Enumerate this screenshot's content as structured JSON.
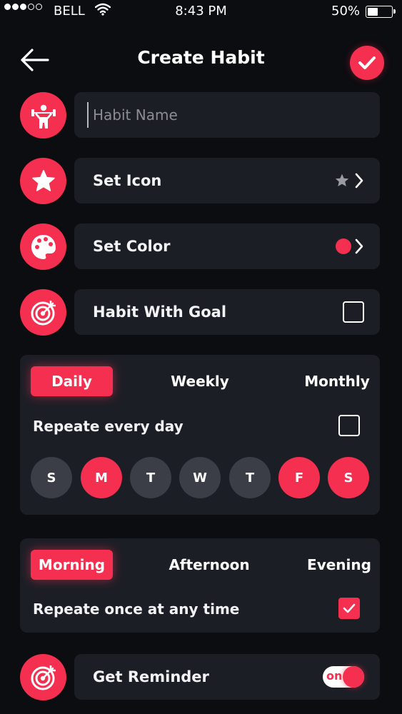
{
  "status": {
    "carrier": "BELL",
    "time": "8:43 PM",
    "battery": "50%",
    "battery_level": 0.5
  },
  "header": {
    "title": "Create Habit"
  },
  "name_field": {
    "placeholder": "Habit Name",
    "value": ""
  },
  "set_icon": {
    "label": "Set Icon"
  },
  "set_color": {
    "label": "Set Color",
    "color": "#f52f4f"
  },
  "habit_goal": {
    "label": "Habit With Goal",
    "checked": false
  },
  "frequency": {
    "tabs": [
      "Daily",
      "Weekly",
      "Monthly"
    ],
    "selected": "Daily",
    "repeat_label": "Repeate every day",
    "repeat_checked": false,
    "days": [
      {
        "label": "S",
        "on": false
      },
      {
        "label": "M",
        "on": true
      },
      {
        "label": "T",
        "on": false
      },
      {
        "label": "W",
        "on": false
      },
      {
        "label": "T",
        "on": false
      },
      {
        "label": "F",
        "on": true
      },
      {
        "label": "S",
        "on": true
      }
    ]
  },
  "time_of_day": {
    "tabs": [
      "Morning",
      "Afternoon",
      "Evening"
    ],
    "selected": "Morning",
    "repeat_label": "Repeate once at any time",
    "repeat_checked": true
  },
  "reminder": {
    "label": "Get Reminder",
    "toggle_label": "on",
    "enabled": true
  },
  "colors": {
    "accent": "#f52f4f",
    "background": "#0c0d11",
    "card": "#1c1e26",
    "day_off": "#3b3e47"
  },
  "icons": {
    "back": "arrow-left-icon",
    "confirm": "check-icon",
    "name": "weightlifter-icon",
    "icon": "star-icon",
    "color": "palette-icon",
    "goal": "target-icon",
    "reminder": "target-icon"
  }
}
